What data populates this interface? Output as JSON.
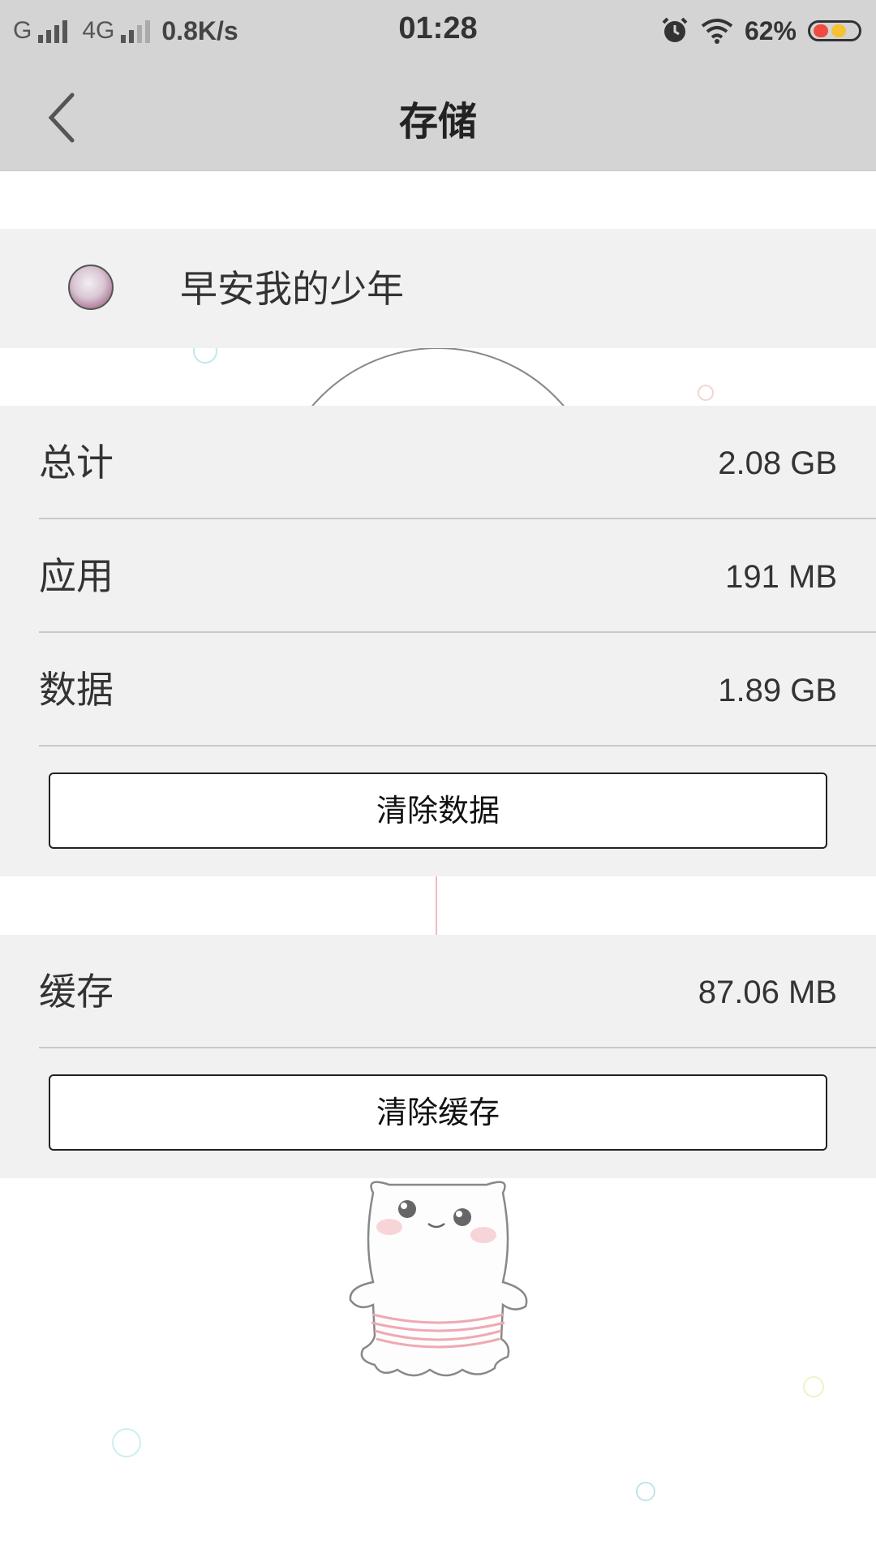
{
  "status_bar": {
    "carrier1": "G",
    "carrier2": "4G",
    "speed": "0.8K/s",
    "time": "01:28",
    "battery": "62%"
  },
  "header": {
    "title": "存储",
    "back_icon": "chevron-left-icon"
  },
  "app": {
    "name": "早安我的少年"
  },
  "storage": {
    "rows": [
      {
        "label": "总计",
        "value": "2.08 GB"
      },
      {
        "label": "应用",
        "value": "191 MB"
      },
      {
        "label": "数据",
        "value": "1.89 GB"
      }
    ],
    "clear_data_label": "清除数据"
  },
  "cache": {
    "label": "缓存",
    "value": "87.06 MB",
    "clear_cache_label": "清除缓存"
  },
  "colors": {
    "header_bg": "#d4d4d4",
    "panel_bg": "#f1f1f1",
    "battery_red": "#ef4b3f",
    "battery_yellow": "#f6c133"
  }
}
